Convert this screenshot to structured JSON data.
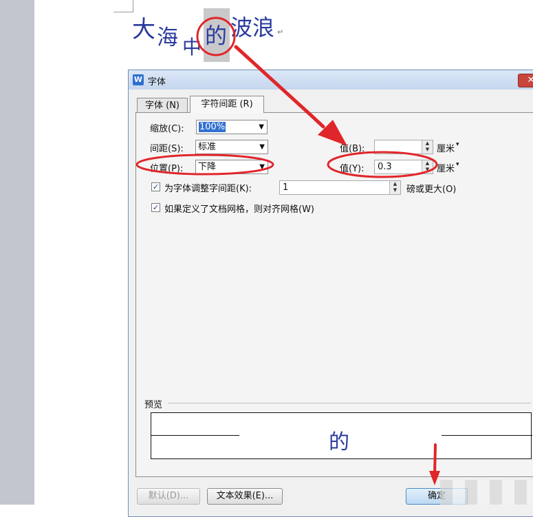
{
  "document": {
    "chars": [
      "大",
      "海",
      "中",
      "的",
      "波浪"
    ],
    "paragraph_mark": "↵"
  },
  "dialog": {
    "title": "字体",
    "app_icon": "W",
    "close_icon": "close-icon",
    "tabs": [
      {
        "label": "字体 (N)"
      },
      {
        "label": "字符间距 (R)",
        "active": true
      }
    ],
    "scale": {
      "label": "缩放(C):",
      "value": "100%"
    },
    "spacing": {
      "label": "间距(S):",
      "value": "标准"
    },
    "spacing_value": {
      "label": "值(B):",
      "value": "",
      "unit": "厘米"
    },
    "position": {
      "label": "位置(P):",
      "value": "下降"
    },
    "position_value": {
      "label": "值(Y):",
      "value": "0.3",
      "unit": "厘米"
    },
    "kerning": {
      "checked": true,
      "label": "为字体调整字间距(K):",
      "value": "1",
      "suffix": "磅或更大(O)"
    },
    "grid": {
      "checked": true,
      "label": "如果定义了文档网格，则对齐网格(W)"
    },
    "preview": {
      "label": "预览",
      "char": "的"
    },
    "buttons": {
      "default": "默认(D)...",
      "text_effects": "文本效果(E)...",
      "ok": "确定"
    }
  },
  "colors": {
    "annotation": "#e0262a",
    "doc_text": "#2a3a9e",
    "selection": "#3271d0"
  }
}
